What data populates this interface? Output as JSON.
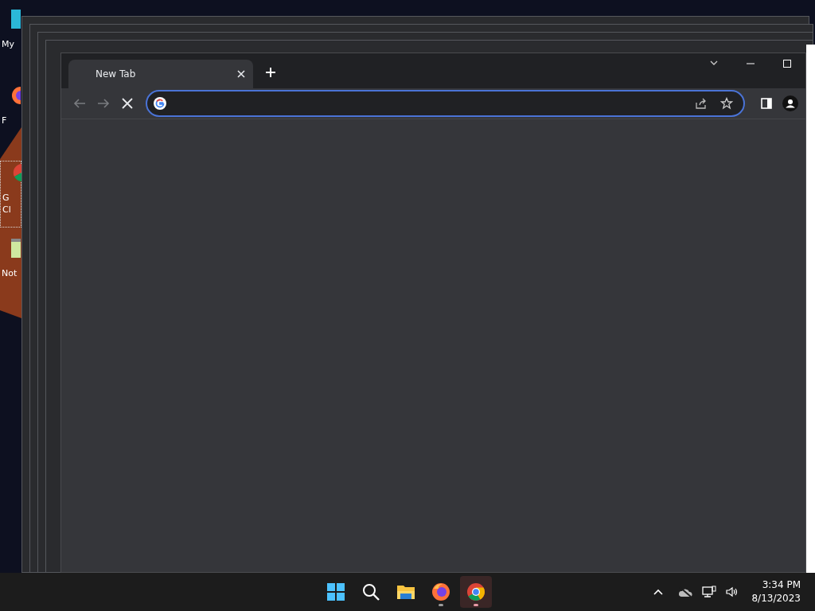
{
  "desktop_icons": [
    {
      "kind": "computer",
      "lines": [
        "My"
      ],
      "selected": false
    },
    {
      "kind": "firefox",
      "lines": [
        "F"
      ],
      "selected": false
    },
    {
      "kind": "chrome",
      "lines": [
        "G",
        "Cl"
      ],
      "selected": true
    },
    {
      "kind": "notepad",
      "lines": [
        "Not"
      ],
      "selected": false
    }
  ],
  "browser": {
    "tabs": [
      {
        "title": "New Tab",
        "selected": true
      }
    ],
    "navigation": [
      {
        "kind": "back",
        "disabled": true
      },
      {
        "kind": "forward",
        "disabled": true
      },
      {
        "kind": "stop",
        "disabled": false
      }
    ],
    "address_bar": {
      "focused": true
    }
  },
  "taskbar": {
    "apps": [
      {
        "kind": "start",
        "running": false,
        "active": false
      },
      {
        "kind": "search",
        "running": false,
        "active": false
      },
      {
        "kind": "files",
        "running": false,
        "active": false
      },
      {
        "kind": "firefox",
        "running": true,
        "active": false
      },
      {
        "kind": "chrome",
        "running": true,
        "active": true
      }
    ],
    "clock": {
      "time": "3:34 PM",
      "date": "8/13/2023"
    }
  }
}
